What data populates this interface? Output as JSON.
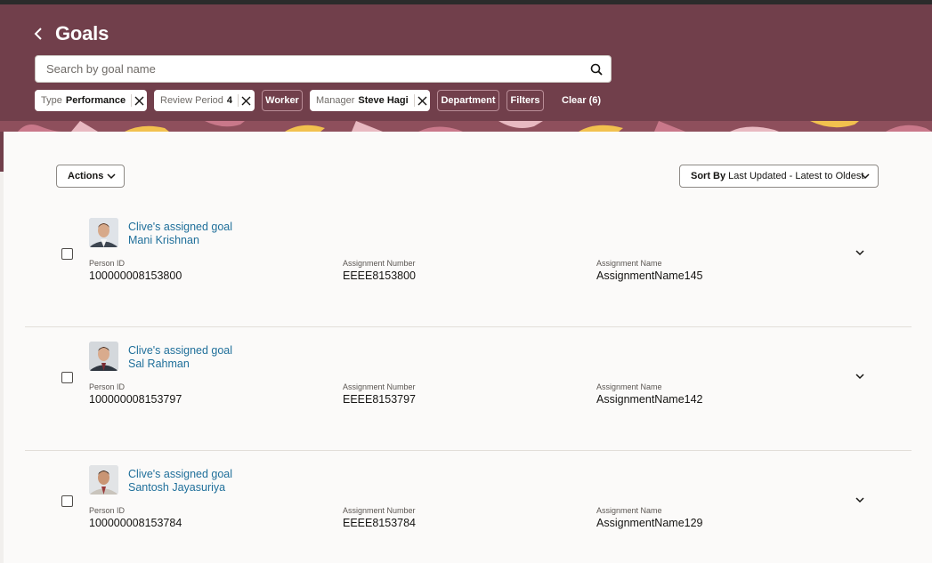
{
  "header": {
    "title": "Goals",
    "back_icon": "chevron-left-icon",
    "background": "#713f4b"
  },
  "search": {
    "placeholder": "Search by goal name",
    "value": "",
    "icon": "search-icon"
  },
  "filters": {
    "chips": [
      {
        "label": "Type",
        "value": "Performance",
        "removable": true
      },
      {
        "label": "Review Period",
        "value": "4",
        "removable": true
      },
      {
        "label": "Worker",
        "value": "",
        "removable": false
      },
      {
        "label": "Manager",
        "value": "Steve Hagi",
        "removable": true
      },
      {
        "label": "Department",
        "value": "",
        "removable": false
      },
      {
        "label": "Filters",
        "value": "",
        "removable": false
      }
    ],
    "clear_label": "Clear (6)"
  },
  "toolbar": {
    "actions_label": "Actions",
    "sort_prefix": "Sort By",
    "sort_value": "Last Updated - Latest to Oldest"
  },
  "field_labels": {
    "person_id": "Person ID",
    "assignment_number": "Assignment Number",
    "assignment_name": "Assignment Name"
  },
  "goals": [
    {
      "goal": "Clive's assigned goal",
      "worker": "Mani Krishnan",
      "person_id": "100000008153800",
      "assignment_number": "EEEE8153800",
      "assignment_name": "AssignmentName145",
      "checked": false
    },
    {
      "goal": "Clive's assigned goal",
      "worker": "Sal Rahman",
      "person_id": "100000008153797",
      "assignment_number": "EEEE8153797",
      "assignment_name": "AssignmentName142",
      "checked": false
    },
    {
      "goal": "Clive's assigned goal",
      "worker": "Santosh Jayasuriya",
      "person_id": "100000008153784",
      "assignment_number": "EEEE8153784",
      "assignment_name": "AssignmentName129",
      "checked": false
    }
  ],
  "colors": {
    "brand": "#713f4b",
    "link": "#1f6f9a",
    "panel": "#fbfaf9"
  }
}
